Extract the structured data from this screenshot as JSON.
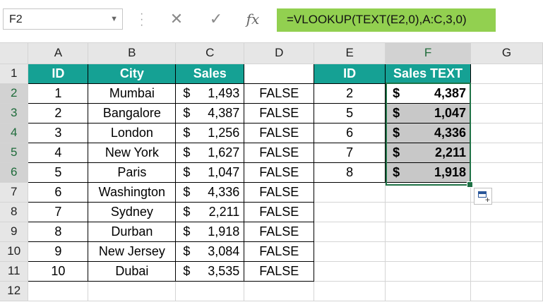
{
  "name_box": {
    "value": "F2"
  },
  "formula_bar": {
    "cancel_glyph": "✕",
    "enter_glyph": "✓",
    "fx_label": "fx",
    "formula": "=VLOOKUP(TEXT(E2,0),A:C,3,0)"
  },
  "columns": [
    "A",
    "B",
    "C",
    "D",
    "E",
    "F",
    "G"
  ],
  "rows": [
    "1",
    "2",
    "3",
    "4",
    "5",
    "6",
    "7",
    "8",
    "9",
    "10",
    "11",
    "12"
  ],
  "headers": {
    "a": "ID",
    "b": "City",
    "c": "Sales",
    "e": "ID",
    "f": "Sales TEXT"
  },
  "table": [
    {
      "id": "1",
      "city": "Mumbai",
      "cur": "$",
      "sales": "1,493",
      "d": "FALSE"
    },
    {
      "id": "2",
      "city": "Bangalore",
      "cur": "$",
      "sales": "4,387",
      "d": "FALSE"
    },
    {
      "id": "3",
      "city": "London",
      "cur": "$",
      "sales": "1,256",
      "d": "FALSE"
    },
    {
      "id": "4",
      "city": "New York",
      "cur": "$",
      "sales": "1,627",
      "d": "FALSE"
    },
    {
      "id": "5",
      "city": "Paris",
      "cur": "$",
      "sales": "1,047",
      "d": "FALSE"
    },
    {
      "id": "6",
      "city": "Washington",
      "cur": "$",
      "sales": "4,336",
      "d": "FALSE"
    },
    {
      "id": "7",
      "city": "Sydney",
      "cur": "$",
      "sales": "2,211",
      "d": "FALSE"
    },
    {
      "id": "8",
      "city": "Durban",
      "cur": "$",
      "sales": "1,918",
      "d": "FALSE"
    },
    {
      "id": "9",
      "city": "New Jersey",
      "cur": "$",
      "sales": "3,084",
      "d": "FALSE"
    },
    {
      "id": "10",
      "city": "Dubai",
      "cur": "$",
      "sales": "3,535",
      "d": "FALSE"
    }
  ],
  "lookup": [
    {
      "id": "2",
      "cur": "$",
      "value": "4,387"
    },
    {
      "id": "5",
      "cur": "$",
      "value": "1,047"
    },
    {
      "id": "6",
      "cur": "$",
      "value": "4,336"
    },
    {
      "id": "7",
      "cur": "$",
      "value": "2,211"
    },
    {
      "id": "8",
      "cur": "$",
      "value": "1,918"
    }
  ],
  "colors": {
    "header_teal": "#15a194",
    "formula_highlight": "#92d050",
    "selection_green": "#1e7145"
  }
}
